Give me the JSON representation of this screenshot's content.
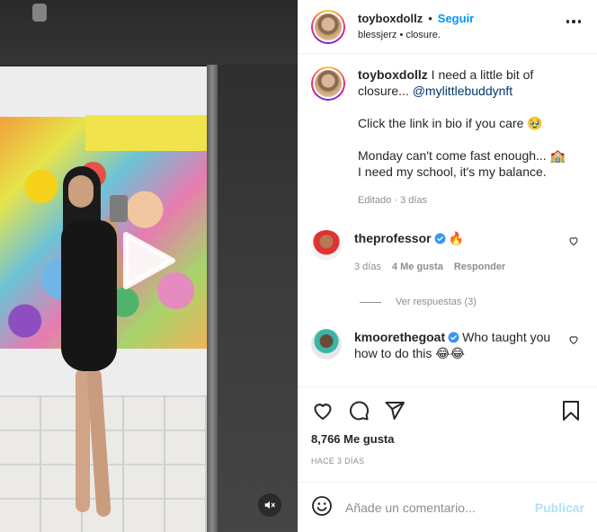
{
  "post": {
    "author": "toyboxdollz",
    "follow_label": "Seguir",
    "bullet": "•",
    "subtitle": "blessjerz • closure."
  },
  "caption": {
    "author": "toyboxdollz",
    "line1": "I need a little bit of closure... ",
    "mention": "@mylittlebuddynft",
    "line2": "Click the link in bio if you care 🥹",
    "line3": "Monday can't come fast enough... 🏫",
    "line4": "I need my school, it's my balance.",
    "meta": "Editado · 3 días"
  },
  "comments": [
    {
      "author": "theprofessor",
      "verified": true,
      "text": "🔥",
      "time": "3 días",
      "likes": "4 Me gusta",
      "reply_label": "Responder",
      "view_replies": "Ver respuestas (3)"
    },
    {
      "author": "kmoorethegoat",
      "verified": true,
      "text": "Who taught you how to do this 😂😂"
    }
  ],
  "actions": {
    "icons": [
      "heart-icon",
      "comment-icon",
      "share-icon",
      "bookmark-icon"
    ]
  },
  "likes_count": "8,766 Me gusta",
  "time_ago": "HACE 3 DÍAS",
  "add_comment": {
    "placeholder": "Añade un comentario...",
    "publish_label": "Publicar",
    "emoji_icon": "smile-icon"
  },
  "video": {
    "controls": [
      "play-icon",
      "mute-icon"
    ]
  },
  "colors": {
    "accent": "#0095f6",
    "publish_disabled": "#b2dffc",
    "verified": "#3897f0",
    "secondary_text": "#8e8e8e",
    "mention": "#00376b"
  }
}
